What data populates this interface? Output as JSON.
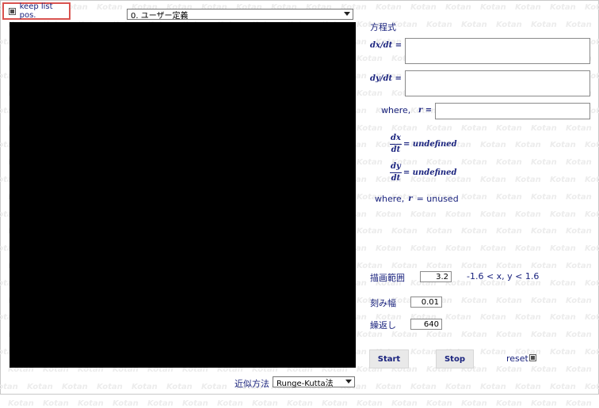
{
  "header": {
    "keep_list_label": "keep list pos.",
    "keep_list_checked": true,
    "equation_select_value": "0. ユーザー定義"
  },
  "equations": {
    "heading": "方程式",
    "dx_label": "dx/dt =",
    "dy_label": "dy/dt =",
    "where_label": "where,",
    "r_label": "r =",
    "dx_input_value": "",
    "dy_input_value": "",
    "r_input_value": ""
  },
  "preview": {
    "dx_num": "dx",
    "dx_den": "dt",
    "dx_value": "= undefined",
    "dy_num": "dy",
    "dy_den": "dt",
    "dy_value": "= undefined",
    "where_label": "where,",
    "r_var": "r",
    "r_value": "= unused"
  },
  "settings": {
    "range_label": "描画範囲",
    "range_value": "3.2",
    "range_expr": "-1.6 < x, y < 1.6",
    "step_label": "刻み幅",
    "step_value": "0.01",
    "repeat_label": "繰返し",
    "repeat_value": "640"
  },
  "controls": {
    "start_label": "Start",
    "stop_label": "Stop",
    "reset_label": "reset",
    "reset_checked": true
  },
  "footer": {
    "method_label": "近似方法",
    "method_value": "Runge-Kutta法"
  },
  "watermark": {
    "text": "Kotan"
  },
  "colors": {
    "text": "#1a237e",
    "highlight_border": "#d9534f",
    "canvas": "#000000",
    "button_bg": "#e9e9e9"
  }
}
